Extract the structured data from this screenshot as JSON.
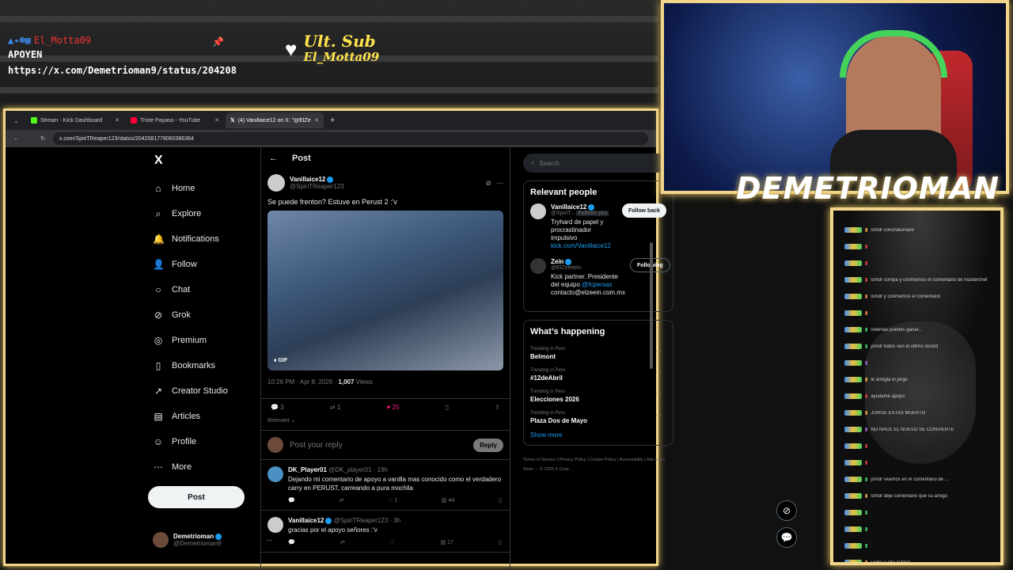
{
  "overlay": {
    "user": "El_Motta09",
    "line2": "APOYEN",
    "link": "https://x.com/Demetrioman9/status/204208",
    "ult_sub_title": "Ult. Sub",
    "ult_sub_name": "El_Motta09"
  },
  "browser": {
    "tabs": [
      {
        "label": "Stream - Kick Dashboard",
        "color": "#53fc18"
      },
      {
        "label": "Triste Payaso - YouTube",
        "color": "#ff0033"
      },
      {
        "label": "(4) Vanillaice12 on X: \"@ElZeee...",
        "color": "#ffffff"
      }
    ],
    "url": "x.com/SpiriTReaper123/status/2042081778060386364"
  },
  "nav": {
    "logo": "X",
    "items": [
      {
        "label": "Home",
        "icon": "home-icon",
        "glyph": "⌂"
      },
      {
        "label": "Explore",
        "icon": "search-icon",
        "glyph": "⌕"
      },
      {
        "label": "Notifications",
        "icon": "bell-icon",
        "glyph": "🔔"
      },
      {
        "label": "Follow",
        "icon": "person-add-icon",
        "glyph": "👤"
      },
      {
        "label": "Chat",
        "icon": "chat-icon",
        "glyph": "○"
      },
      {
        "label": "Grok",
        "icon": "grok-icon",
        "glyph": "⊘"
      },
      {
        "label": "Premium",
        "icon": "premium-icon",
        "glyph": "◎"
      },
      {
        "label": "Bookmarks",
        "icon": "bookmark-icon",
        "glyph": "▯"
      },
      {
        "label": "Creator Studio",
        "icon": "rocket-icon",
        "glyph": "↗"
      },
      {
        "label": "Articles",
        "icon": "article-icon",
        "glyph": "▤"
      },
      {
        "label": "Profile",
        "icon": "profile-icon",
        "glyph": "☺"
      },
      {
        "label": "More",
        "icon": "more-icon",
        "glyph": "⋯"
      }
    ],
    "post_label": "Post",
    "me_name": "Demetrioman",
    "me_handle": "@Demetrioman9"
  },
  "post": {
    "header": "Post",
    "author_name": "Vanillaice12",
    "author_handle": "@SpiriTReaper123",
    "text": "Se puede frenton? Estuve en Perust  2 :'v",
    "gif_label": "GIF",
    "time": "10:26 PM · Apr 8, 2026 · ",
    "views_count": "1,007",
    "views_label": "Views",
    "replies": "3",
    "reposts": "1",
    "likes": "25",
    "sort": "Relevant",
    "reply_placeholder": "Post your reply",
    "reply_button": "Reply"
  },
  "replies": [
    {
      "name": "DK_Player01",
      "meta": "@DK_player01 · 19h",
      "text": "Dejando mi comentario de apoyo a vanilla mas conocido como el verdadero carry en PERUST, carreando a pura mochila",
      "counts": [
        "",
        "",
        "1",
        "44"
      ]
    },
    {
      "name": "Vanillaice12",
      "meta": "@SpiriTReaper123 · 3h",
      "text": "gracias por el apoyo señores :'v",
      "counts": [
        "",
        "",
        "",
        "17"
      ]
    }
  ],
  "right": {
    "search_placeholder": "Search",
    "relevant_title": "Relevant people",
    "people": [
      {
        "name": "Vanillaice12",
        "handle": "@SpiriT...",
        "follows_you": "Follows you",
        "bio": "Tryhard de papel y procrastinador impulsivo ",
        "link": "kick.com/Vanillaice12",
        "button": "Follow back"
      },
      {
        "name": "Zein",
        "handle": "@ElZeeeein",
        "follows_you": "",
        "bio": "Kick partner. Presidente del equipo ",
        "link": "@fcpersas",
        "bio2": " contacto@elzeein.com.mx",
        "button": "Following"
      }
    ],
    "happening_title": "What’s happening",
    "trends": [
      {
        "ctx": "Trending in Peru",
        "topic": "Belmont"
      },
      {
        "ctx": "Trending in Peru",
        "topic": "#12deAbril"
      },
      {
        "ctx": "Trending in Peru",
        "topic": "Elecciones 2026"
      },
      {
        "ctx": "Trending in Peru",
        "topic": "Plaza Dos de Mayo"
      }
    ],
    "show_more": "Show more",
    "footer": "Terms of Service  |  Privacy Policy  |  Cookie Policy  |  Accessibility  |  Ads info  |  More ···  © 2026 X Corp."
  },
  "cam": {
    "name": "DEMETRIOMAN"
  },
  "chat": {
    "messages": [
      {
        "name": "",
        "color": "#e0a040",
        "msg": "lsmdr conchatumare"
      },
      {
        "name": "",
        "color": "#d04040",
        "msg": ""
      },
      {
        "name": "",
        "color": "#d04040",
        "msg": ""
      },
      {
        "name": "",
        "color": "#d04040",
        "msg": "lsmdr compa y conmemos el comentario de masterchef"
      },
      {
        "name": "",
        "color": "#e08040",
        "msg": "lsmdr y conmemos el comentario"
      },
      {
        "name": "",
        "color": "#e08040",
        "msg": ""
      },
      {
        "name": "",
        "color": "#40c060",
        "msg": "Ademas puedes ganar..."
      },
      {
        "name": "",
        "color": "#40c060",
        "msg": "jsmdr todos ven el ultimo record"
      },
      {
        "name": "",
        "color": "#a060d0",
        "msg": ""
      },
      {
        "name": "",
        "color": "#e0a040",
        "msg": "le arregla el jorge"
      },
      {
        "name": "",
        "color": "#d04040",
        "msg": "ayudame apoyo"
      },
      {
        "name": "",
        "color": "#e0a040",
        "msg": "JORGE ESTAS MUERTO"
      },
      {
        "name": "",
        "color": "#a060d0",
        "msg": "NO NACE EL NUEVO SE CONVIERTE"
      },
      {
        "name": "",
        "color": "#d04040",
        "msg": ""
      },
      {
        "name": "",
        "color": "#d04040",
        "msg": ""
      },
      {
        "name": "",
        "color": "#40c060",
        "msg": "jsmdr veamos en el comentario de ..."
      },
      {
        "name": "",
        "color": "#e0a040",
        "msg": "lsmdr deje comentario que su amigo"
      },
      {
        "name": "",
        "color": "#40c060",
        "msg": ""
      },
      {
        "name": "",
        "color": "#40c060",
        "msg": ""
      },
      {
        "name": "",
        "color": "#40c060",
        "msg": ""
      },
      {
        "name": "",
        "color": "#e0a040",
        "msg": "j pide a ella al final"
      }
    ]
  }
}
